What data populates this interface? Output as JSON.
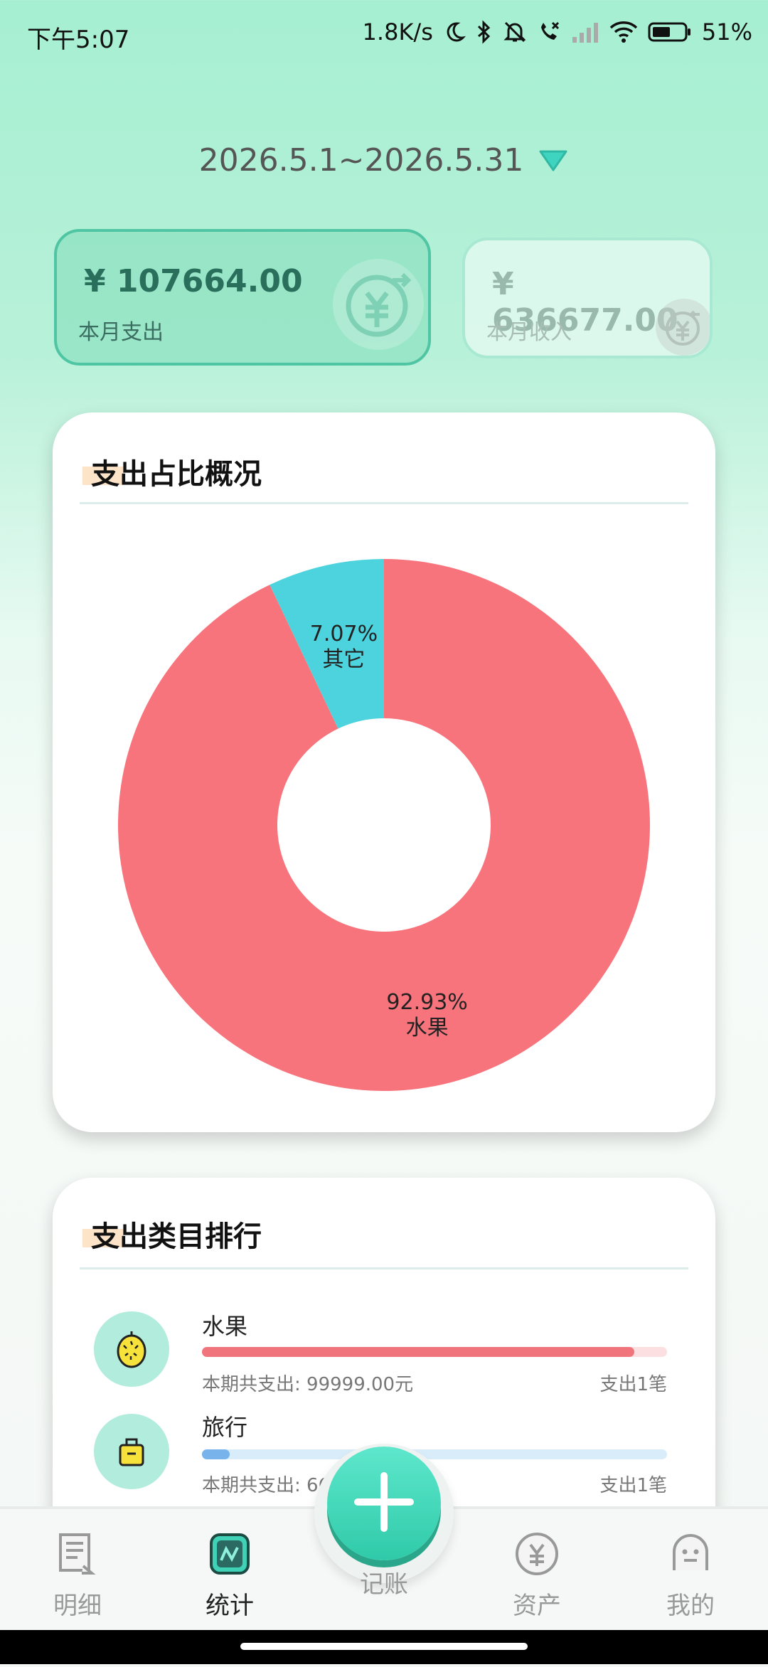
{
  "status_bar": {
    "time": "下午5:07",
    "speed": "1.8K/s",
    "battery": "51%"
  },
  "date_range": "2026.5.1~2026.5.31",
  "summary": {
    "expense_amount": "¥ 107664.00",
    "expense_label": "本月支出",
    "income_amount": "¥ 636677.00",
    "income_label": "本月收入"
  },
  "pie_card": {
    "title": "支出占比概况"
  },
  "chart_data": {
    "type": "pie",
    "donut": true,
    "slices": [
      {
        "label": "水果",
        "percent_label": "92.93%",
        "value": 92.93,
        "color": "#f8747c"
      },
      {
        "label": "其它",
        "percent_label": "7.07%",
        "value": 7.07,
        "color": "#4dd3dd"
      }
    ]
  },
  "ranking_card": {
    "title": "支出类目排行",
    "items": [
      {
        "name": "水果",
        "subtitle": "本期共支出: 99999.00元",
        "count": "支出1笔",
        "ratio": 0.93,
        "bar_color": "#f0747c",
        "track_color": "#fbdfe1",
        "icon": "durian-icon"
      },
      {
        "name": "旅行",
        "subtitle": "本期共支出: 66",
        "count": "支出1笔",
        "ratio": 0.06,
        "bar_color": "#78b3ec",
        "track_color": "#d9ecfa",
        "icon": "luggage-icon"
      }
    ]
  },
  "nav": {
    "items": [
      {
        "label": "明细",
        "icon": "document-icon"
      },
      {
        "label": "统计",
        "icon": "stats-icon"
      },
      {
        "label": "记账",
        "icon": "plus-icon"
      },
      {
        "label": "资产",
        "icon": "yuan-coin-icon"
      },
      {
        "label": "我的",
        "icon": "face-icon"
      }
    ]
  }
}
